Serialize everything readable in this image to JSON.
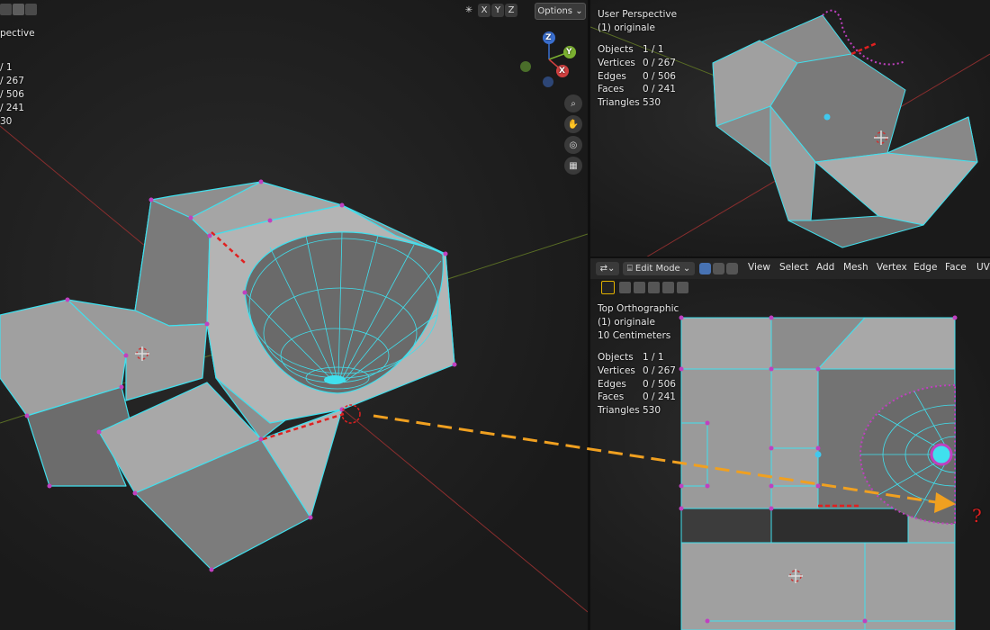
{
  "left_viewport": {
    "overlay_fragment": "pective",
    "stat_fragments": [
      "/ 1",
      "/ 267",
      "/ 506",
      "/ 241",
      "30"
    ],
    "axis_buttons": [
      "X",
      "Y",
      "Z"
    ],
    "options_label": "Options",
    "gizmo_labels": {
      "z": "Z",
      "y": "Y",
      "x": "X"
    }
  },
  "top_right_viewport": {
    "title": "User Perspective",
    "object_name": "(1) originale",
    "stats": [
      {
        "label": "Objects",
        "value": "1 / 1"
      },
      {
        "label": "Vertices",
        "value": "0 / 267"
      },
      {
        "label": "Edges",
        "value": "0 / 506"
      },
      {
        "label": "Faces",
        "value": "0 / 241"
      },
      {
        "label": "Triangles",
        "value": "530"
      }
    ]
  },
  "header": {
    "mode": "Edit Mode",
    "menus": [
      "View",
      "Select",
      "Add",
      "Mesh",
      "Vertex",
      "Edge",
      "Face",
      "UV"
    ]
  },
  "bottom_right_viewport": {
    "title": "Top Orthographic",
    "object_name": "(1) originale",
    "scale": "10 Centimeters",
    "stats": [
      {
        "label": "Objects",
        "value": "1 / 1"
      },
      {
        "label": "Vertices",
        "value": "0 / 267"
      },
      {
        "label": "Edges",
        "value": "0 / 506"
      },
      {
        "label": "Faces",
        "value": "0 / 241"
      },
      {
        "label": "Triangles",
        "value": "530"
      }
    ],
    "annotation": "?"
  },
  "colors": {
    "mesh_face": "#9a9a9a",
    "mesh_edge": "#40e0ee",
    "vertex": "#c040c0",
    "annotation_red": "#e02020",
    "arrow_orange": "#f0a020"
  }
}
